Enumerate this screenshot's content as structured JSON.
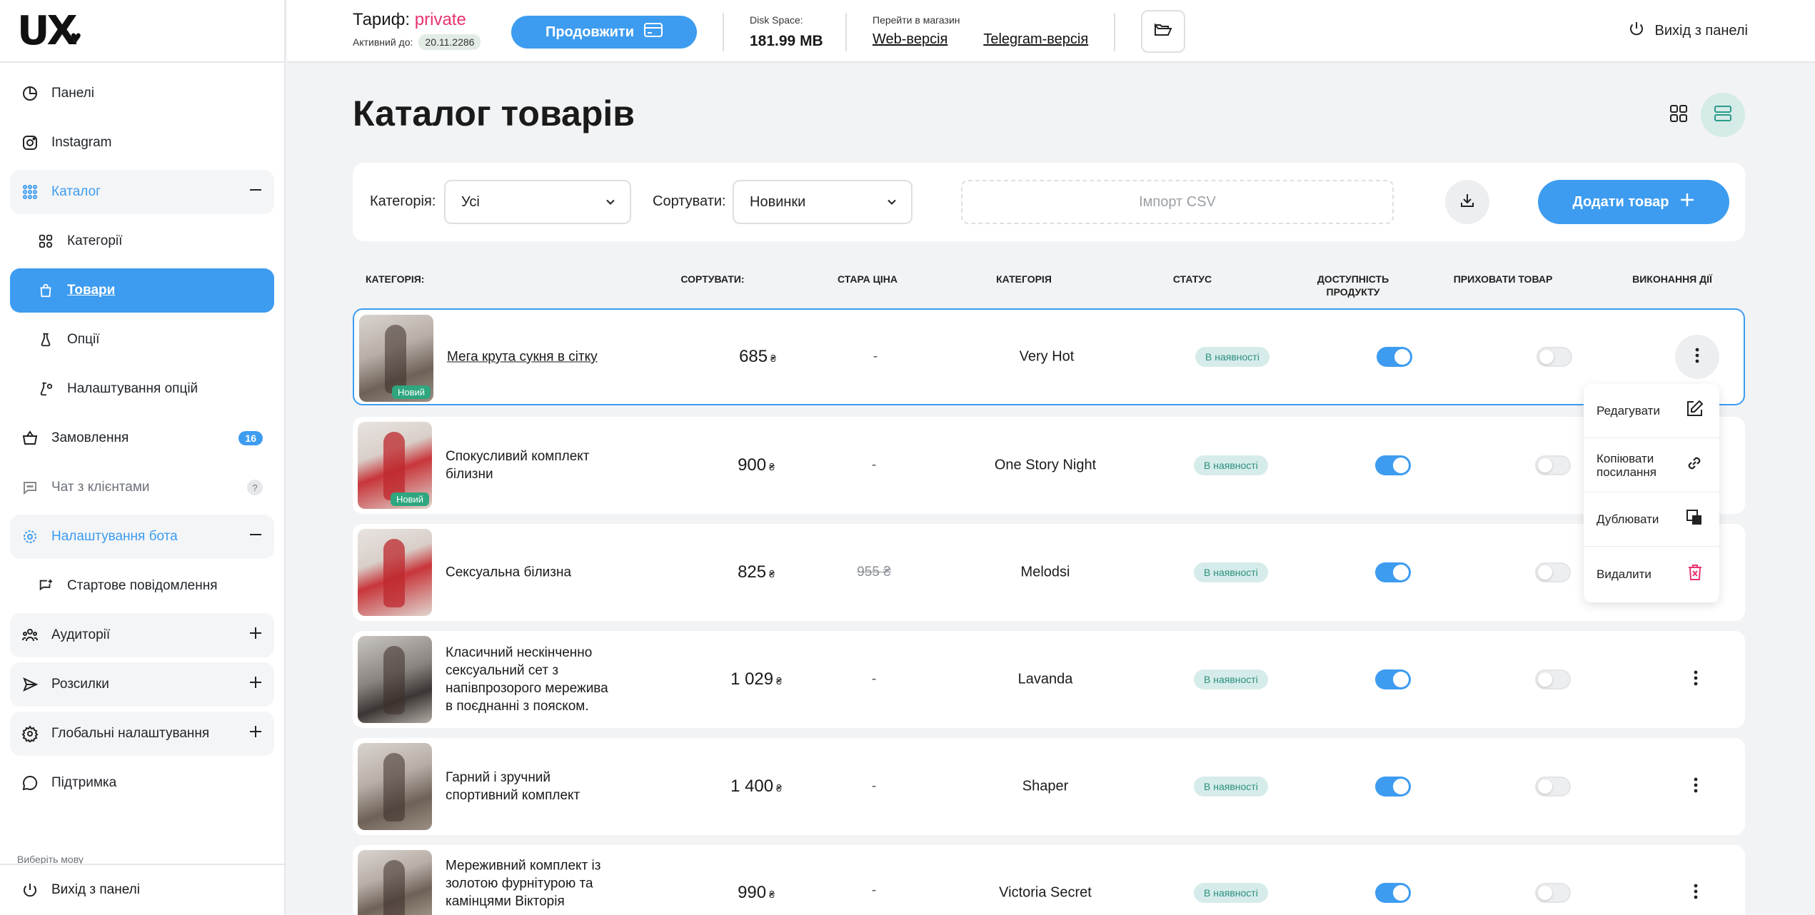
{
  "brand": {
    "logo": "UX"
  },
  "sidebar": {
    "items": [
      {
        "label": "Панелі"
      },
      {
        "label": "Instagram"
      },
      {
        "label": "Каталог"
      },
      {
        "label": "Категорії"
      },
      {
        "label": "Товари"
      },
      {
        "label": "Опції"
      },
      {
        "label": "Налаштування опцій"
      },
      {
        "label": "Замовлення",
        "badge": "16"
      },
      {
        "label": "Чат з клієнтами",
        "badge": "?"
      },
      {
        "label": "Налаштування бота"
      },
      {
        "label": "Стартове повідомлення"
      },
      {
        "label": "Аудиторії"
      },
      {
        "label": "Розсилки"
      },
      {
        "label": "Глобальні налаштування"
      },
      {
        "label": "Підтримка"
      }
    ],
    "lang_label": "Виберіть мову",
    "logout": "Вихід з панелі"
  },
  "topbar": {
    "tariff_label": "Тариф:",
    "tariff_plan": "private",
    "active_label": "Активний до:",
    "active_date": "20.11.2286",
    "continue_button": "Продовжити",
    "disk_label": "Disk Space:",
    "disk_value": "181.99 MB",
    "store_label": "Перейти в магазин",
    "web_link": "Web-версія",
    "telegram_link": "Telegram-версія",
    "logout": "Вихід з панелі"
  },
  "main": {
    "title": "Каталог товарів",
    "filters": {
      "category_label": "Категорія:",
      "category_value": "Усі",
      "sort_label": "Сортувати:",
      "sort_value": "Новинки",
      "import_placeholder": "Імпорт CSV",
      "add_button": "Додати товар"
    },
    "columns": [
      "КАТЕГОРІЯ:",
      "СОРТУВАТИ:",
      "СТАРА ЦІНА",
      "КАТЕГОРІЯ",
      "СТАТУС",
      "ДОСТУПНІСТЬ ПРОДУКТУ",
      "ПРИХОВАТИ ТОВАР",
      "ВИКОНАННЯ ДІЇ"
    ],
    "currency": "₴",
    "products": [
      {
        "name": "Мега крута сукня в сітку",
        "price": "685",
        "old_price": "-",
        "category": "Very Hot",
        "status": "В наявності",
        "tag": "Новий"
      },
      {
        "name": "Спокусливий комплект білизни",
        "price": "900",
        "old_price": "-",
        "category": "One Story Night",
        "status": "В наявності",
        "tag": "Новий"
      },
      {
        "name": "Сексуальна білизна",
        "price": "825",
        "old_price": "955 ₴",
        "category": "Melodsi",
        "status": "В наявності",
        "tag": ""
      },
      {
        "name": "Класичний нескінченно сексуальний сет з напівпрозорого мережива в поєднанні з пояском.",
        "price": "1 029",
        "old_price": "-",
        "category": "Lavanda",
        "status": "В наявності",
        "tag": ""
      },
      {
        "name": "Гарний і зручний спортивний комплект",
        "price": "1 400",
        "old_price": "-",
        "category": "Shaper",
        "status": "В наявності",
        "tag": ""
      },
      {
        "name": "Мереживний комплект із золотою фурнітурою та камінцями Вікторія",
        "price": "990",
        "old_price": "-",
        "category": "Victoria Secret",
        "status": "В наявності",
        "tag": ""
      }
    ],
    "action_menu": [
      "Редагувати",
      "Копіювати посилання",
      "Дублювати",
      "Видалити"
    ]
  },
  "colors": {
    "accent": "#3d9cf0",
    "plan": "#e8336d",
    "status_bg": "#d6ecea",
    "status_text": "#2b8f7e",
    "new_tag": "#2ea67f",
    "delete_icon": "#e8336d"
  }
}
